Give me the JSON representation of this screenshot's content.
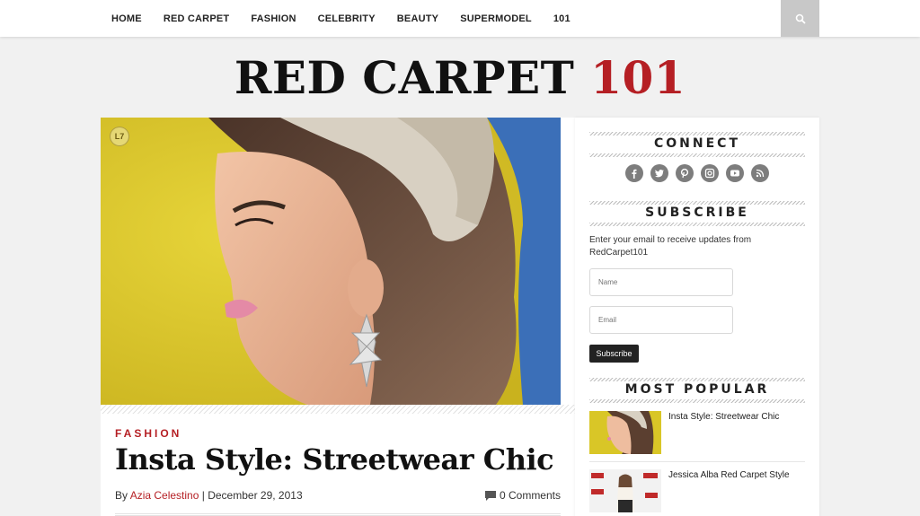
{
  "nav": {
    "items": [
      "HOME",
      "RED CARPET",
      "FASHION",
      "CELEBRITY",
      "BEAUTY",
      "SUPERMODEL",
      "101"
    ]
  },
  "logo": {
    "main": "RED CARPET",
    "accent": "101",
    "accent_color": "#b51f24"
  },
  "post": {
    "category": "FASHION",
    "title": "Insta Style: Streetwear Chic",
    "by": "By",
    "author": "Azia Celestino",
    "separator": "|",
    "date": "December 29, 2013",
    "comments": "0 Comments"
  },
  "sidebar": {
    "connect": {
      "heading": "CONNECT",
      "icons": [
        "facebook-icon",
        "twitter-icon",
        "pinterest-icon",
        "instagram-icon",
        "youtube-icon",
        "rss-icon"
      ]
    },
    "subscribe": {
      "heading": "SUBSCRIBE",
      "text": "Enter your email to receive updates from RedCarpet101",
      "name_placeholder": "Name",
      "email_placeholder": "Email",
      "button": "Subscribe"
    },
    "popular": {
      "heading": "MOST POPULAR",
      "items": [
        {
          "title": "Insta Style: Streetwear Chic"
        },
        {
          "title": "Jessica Alba Red Carpet Style"
        }
      ]
    }
  },
  "colors": {
    "accent": "#b51f24",
    "icon_gray": "#7d7d7d",
    "search_bg": "#c8c8c8"
  }
}
